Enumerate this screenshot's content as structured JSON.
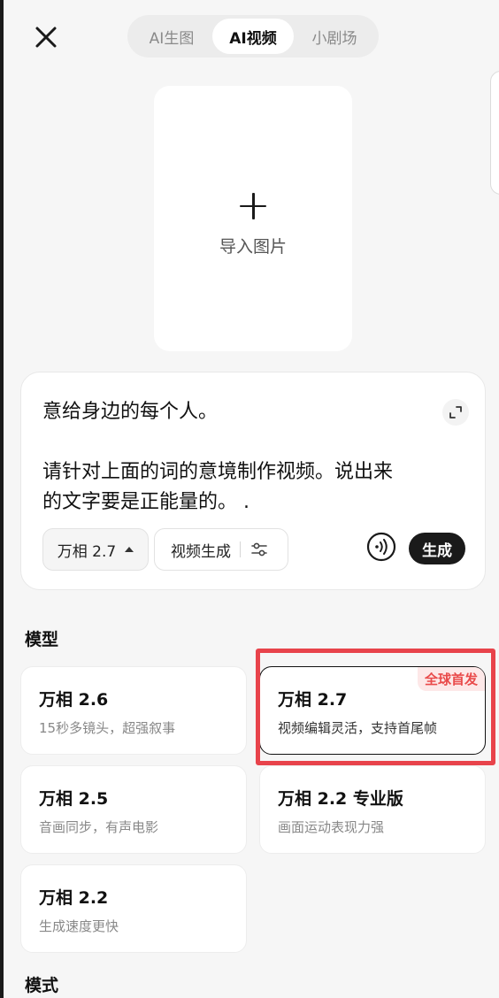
{
  "tabs": [
    {
      "label": "AI生图",
      "active": false
    },
    {
      "label": "AI视频",
      "active": true
    },
    {
      "label": "小剧场",
      "active": false
    }
  ],
  "import": {
    "label": "导入图片"
  },
  "prompt": {
    "text": "意给身边的每个人。\n\n请针对上面的词的意境制作视频。说出来\n的文字要是正能量的。 ."
  },
  "toolbar": {
    "model_label": "万相 2.7",
    "mode_label": "视频生成",
    "generate_label": "生成"
  },
  "sections": {
    "model_title": "模型",
    "mode_title": "模式"
  },
  "models": [
    {
      "name": "万相 2.6",
      "desc": "15秒多镜头，超强叙事",
      "selected": false
    },
    {
      "name": "万相 2.7",
      "desc": "视频编辑灵活，支持首尾帧",
      "selected": true,
      "badge": "全球首发"
    },
    {
      "name": "万相 2.5",
      "desc": "音画同步，有声电影",
      "selected": false
    },
    {
      "name": "万相 2.2 专业版",
      "desc": "画面运动表现力强",
      "selected": false
    },
    {
      "name": "万相 2.2",
      "desc": "生成速度更快",
      "selected": false
    }
  ],
  "colors": {
    "highlight": "#e8434b",
    "badge_text": "#e94b4b",
    "badge_bg": "#fde8e8",
    "generate_bg": "#1a1a1a"
  }
}
